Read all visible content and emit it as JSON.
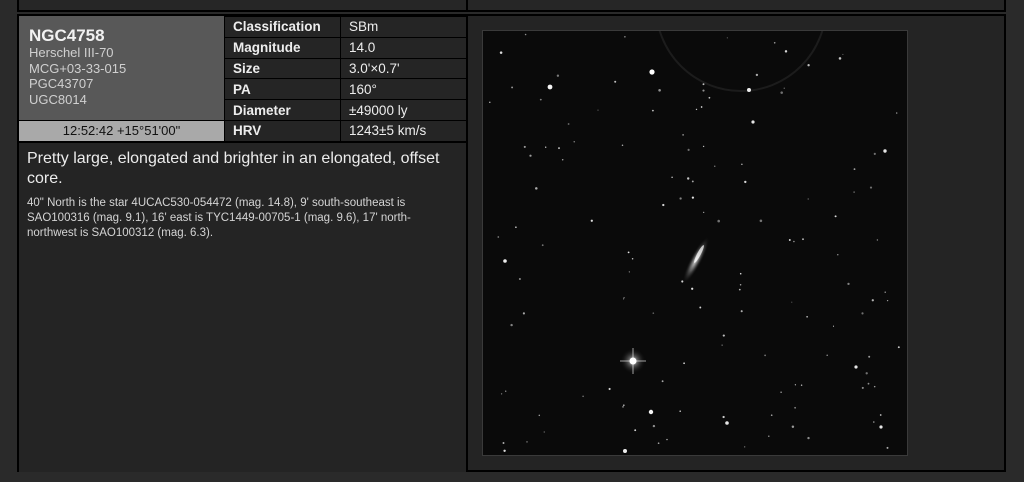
{
  "object": {
    "name": "NGC4758",
    "aliases": [
      "Herschel III-70",
      "MCG+03-33-015",
      "PGC43707",
      "UGC8014"
    ],
    "coordinates": "12:52:42 +15°51'00\""
  },
  "properties": [
    {
      "label": "Classification",
      "value": "SBm"
    },
    {
      "label": "Magnitude",
      "value": "14.0"
    },
    {
      "label": "Size",
      "value": "3.0'×0.7'"
    },
    {
      "label": "PA",
      "value": "160°"
    },
    {
      "label": "Diameter",
      "value": "±49000 ly"
    },
    {
      "label": "HRV",
      "value": "1243±5 km/s"
    }
  ],
  "description": {
    "summary": "Pretty large, elongated and brighter in an elongated, offset core.",
    "detail": "40\" North is the star 4UCAC530-054472 (mag. 14.8), 9' south-southeast is SAO100316 (mag. 9.1), 16' east is TYC1449-00705-1 (mag. 9.6), 17' north-northwest is SAO100312 (mag. 6.3)."
  },
  "colors": {
    "panel": "#242424",
    "id_box": "#585858",
    "coords_bar": "#a9a9a9",
    "sky": "#0a0a0a"
  }
}
